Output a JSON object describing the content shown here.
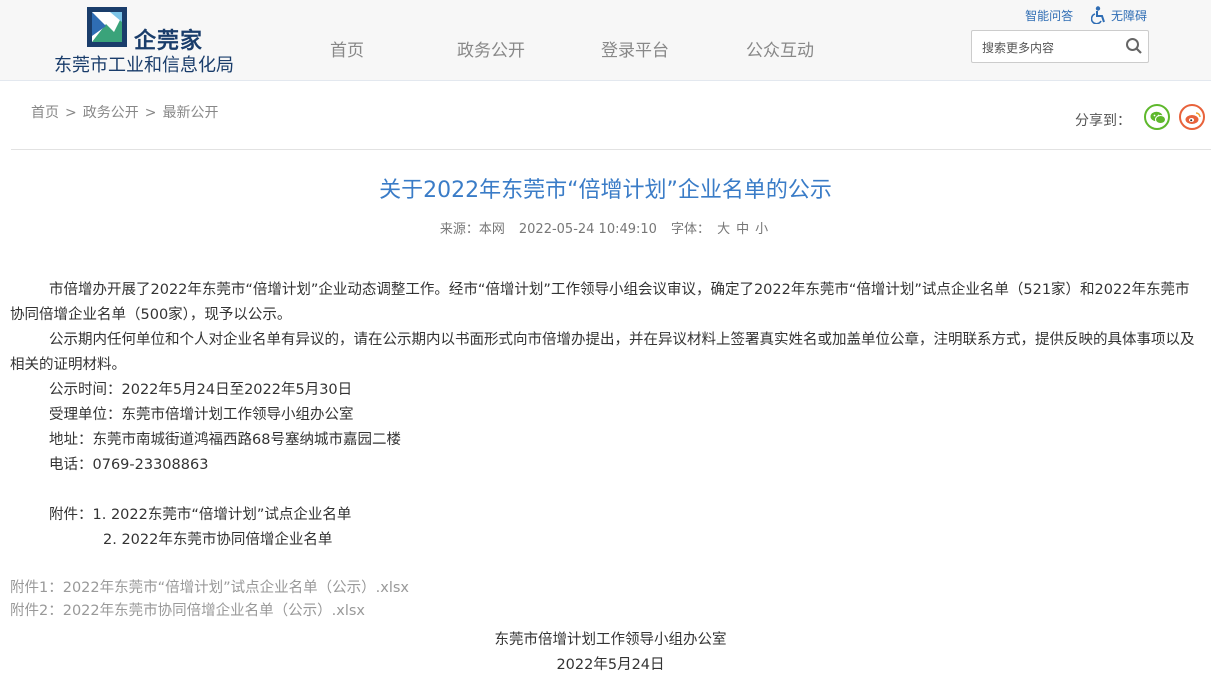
{
  "header": {
    "logo_brand": "企莞家",
    "logo_subtitle": "东莞市工业和信息化局",
    "nav": [
      "首页",
      "政务公开",
      "登录平台",
      "公众互动"
    ],
    "top_links": {
      "ai_qa": "智能问答",
      "accessibility": "无障碍"
    },
    "search_placeholder": "搜索更多内容"
  },
  "breadcrumb": {
    "home": "首页",
    "level2": "政务公开",
    "level3": "最新公开",
    "sep": ">"
  },
  "share": {
    "label": "分享到：",
    "icons": [
      "wechat-icon",
      "weibo-icon"
    ]
  },
  "article": {
    "title": "关于2022年东莞市“倍增计划”企业名单的公示",
    "source_label": "来源：",
    "source": "本网",
    "datetime": "2022-05-24 10:49:10",
    "font_label": "字体：",
    "font_sizes": [
      "大",
      "中",
      "小"
    ],
    "paragraphs": [
      "市倍增办开展了2022年东莞市“倍增计划”企业动态调整工作。经市“倍增计划”工作领导小组会议审议，确定了2022年东莞市“倍增计划”试点企业名单（521家）和2022年东莞市协同倍增企业名单（500家），现予以公示。",
      "公示期内任何单位和个人对企业名单有异议的，请在公示期内以书面形式向市倍增办提出，并在异议材料上签署真实姓名或加盖单位公章，注明联系方式，提供反映的具体事项以及相关的证明材料。"
    ],
    "info_lines": [
      "公示时间：2022年5月24日至2022年5月30日",
      "受理单位：东莞市倍增计划工作领导小组办公室",
      "地址：东莞市南城街道鸿福西路68号塞纳城市嘉园二楼",
      "电话：0769-23308863"
    ],
    "attachment_list": [
      "附件：1.  2022东莞市“倍增计划”试点企业名单",
      "2. 2022年东莞市协同倍增企业名单"
    ],
    "attachment_links": [
      "附件1：2022年东莞市“倍增计划”试点企业名单（公示）.xlsx",
      "附件2：2022年东莞市协同倍增企业名单（公示）.xlsx"
    ],
    "signature_org": "东莞市倍增计划工作领导小组办公室",
    "signature_date": "2022年5月24日"
  },
  "colors": {
    "accent": "#3a7cc7",
    "brand": "#1a3d6b",
    "wechat": "#5eb82c",
    "weibo": "#e8623b"
  }
}
